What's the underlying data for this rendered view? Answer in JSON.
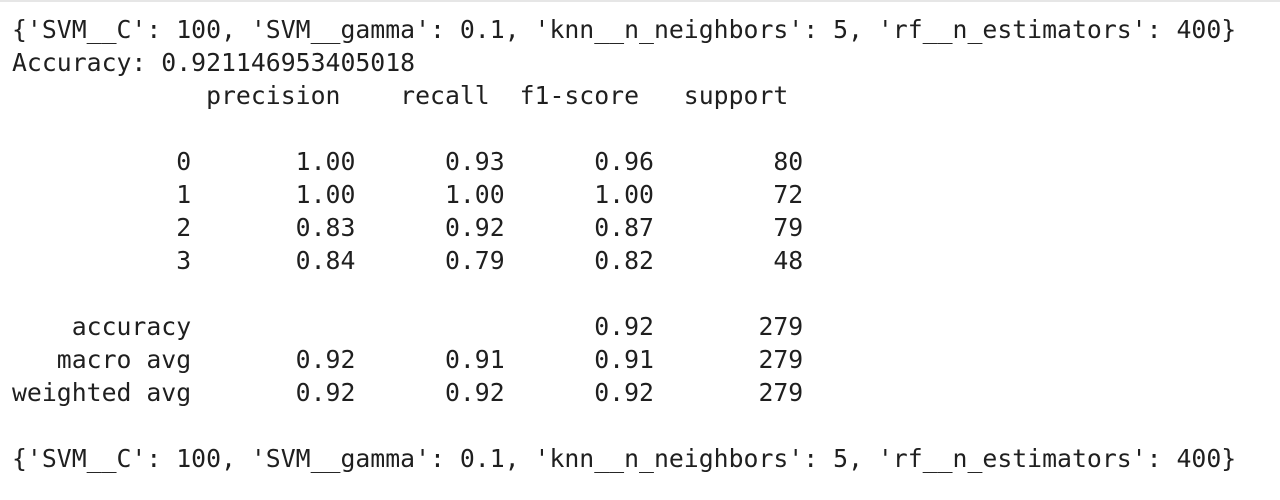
{
  "output": {
    "params_line_1": "{'SVM__C': 100, 'SVM__gamma': 0.1, 'knn__n_neighbors': 5, 'rf__n_estimators': 400}",
    "accuracy_line": "Accuracy: 0.921146953405018",
    "report": {
      "header": "             precision    recall  f1-score   support",
      "rows": [
        "           0       1.00      0.93      0.96        80",
        "           1       1.00      1.00      1.00        72",
        "           2       0.83      0.92      0.87        79",
        "           3       0.84      0.79      0.82        48"
      ],
      "summary": [
        "    accuracy                           0.92       279",
        "   macro avg       0.92      0.91      0.91       279",
        "weighted avg       0.92      0.92      0.92       279"
      ]
    },
    "params_line_2": "{'SVM__C': 100, 'SVM__gamma': 0.1, 'knn__n_neighbors': 5, 'rf__n_estimators': 400}"
  }
}
